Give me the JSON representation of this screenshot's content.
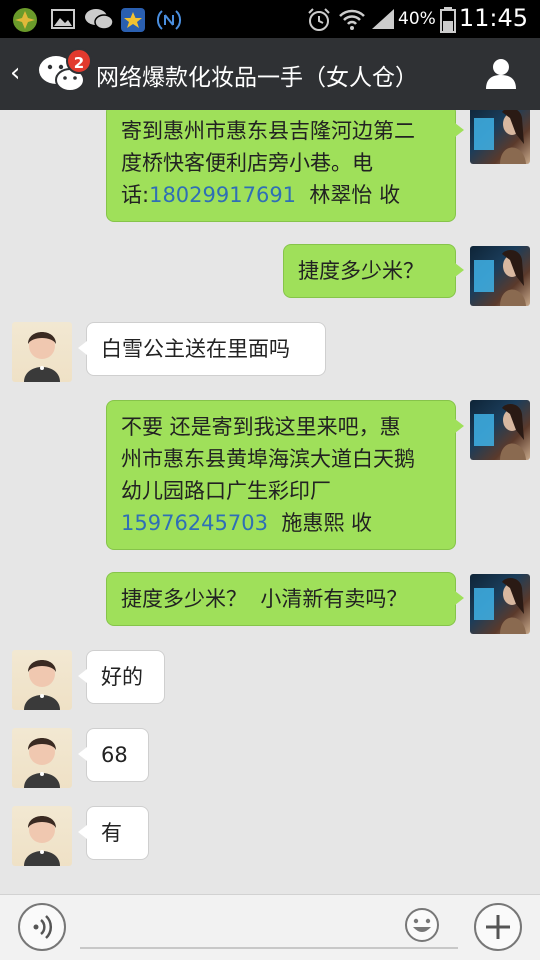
{
  "status_bar": {
    "battery_percent": "40%",
    "time": "11:45"
  },
  "header": {
    "unread_count": "2",
    "title": "网络爆款化妆品一手（女人仓）"
  },
  "messages": [
    {
      "from": "me",
      "lines": [
        "寄到惠州市惠东县吉隆河边第二",
        "度桥快客便利店旁小巷。电"
      ],
      "phone_prefix": "话:",
      "phone": "18029917691",
      "suffix": "  林翠怡 收"
    },
    {
      "from": "me",
      "text": "捷度多少米？"
    },
    {
      "from": "them",
      "text": "白雪公主送在里面吗"
    },
    {
      "from": "me",
      "lines": [
        "不要 还是寄到我这里来吧，惠",
        "州市惠东县黄埠海滨大道白天鹅",
        "幼儿园路口广生彩印厂"
      ],
      "phone": "15976245703",
      "suffix": "  施惠熙 收"
    },
    {
      "from": "me",
      "text": "捷度多少米？  小清新有卖吗？"
    },
    {
      "from": "them",
      "text": "好的"
    },
    {
      "from": "them",
      "text": "68"
    },
    {
      "from": "them",
      "text": "有"
    }
  ],
  "icons": {
    "back": "chevron-left-icon",
    "contacts": "person-icon",
    "voice": "voice-icon",
    "emoji": "emoji-icon",
    "more": "plus-icon"
  }
}
